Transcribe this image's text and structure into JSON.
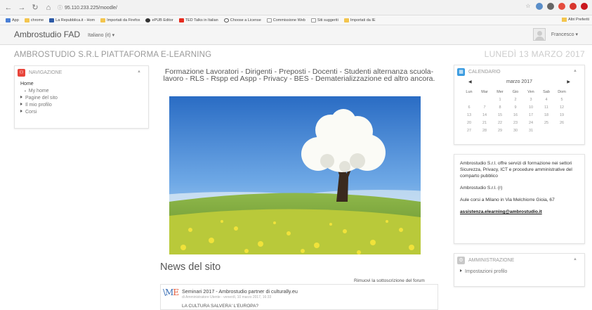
{
  "browser": {
    "url_host": "95.110.233.225",
    "url_path": "/moodle/",
    "bookmarks": [
      "App",
      "chrome",
      "La Repubblica.it - Hom",
      "Importati da Firefox",
      "ePUB Editor",
      "TED Talks in Italian",
      "Choose a License",
      "Commissione Web",
      "Siti suggeriti",
      "Importati da IE"
    ],
    "bookmarks_right": "Altri Preferiti"
  },
  "navbar": {
    "brand": "Ambrostudio FAD",
    "language": "Italiano (it) ▾",
    "user_name": "Francesco ▾"
  },
  "header": {
    "site_name": "AMBROSTUDIO S.R.L PIATTAFORMA E-LEARNING",
    "date": "LUNEDÌ 13 MARZO 2017"
  },
  "navigation": {
    "title": "NAVIGAZIONE",
    "home": "Home",
    "items": [
      "My home",
      "Pagine del sito",
      "Il mio profilo",
      "Corsi"
    ]
  },
  "calendar": {
    "title": "CALENDARIO",
    "prev": "◀",
    "next": "▶",
    "month": "marzo 2017",
    "weekdays": [
      "Lun",
      "Mar",
      "Mer",
      "Gio",
      "Ven",
      "Sab",
      "Dom"
    ],
    "weeks": [
      [
        "",
        "",
        "1",
        "2",
        "3",
        "4",
        "5"
      ],
      [
        "6",
        "7",
        "8",
        "9",
        "10",
        "11",
        "12"
      ],
      [
        "13",
        "14",
        "15",
        "16",
        "17",
        "18",
        "19"
      ],
      [
        "20",
        "21",
        "22",
        "23",
        "24",
        "25",
        "26"
      ],
      [
        "27",
        "28",
        "29",
        "30",
        "31",
        "",
        ""
      ]
    ]
  },
  "info": {
    "description": "Ambrostudio S.r.l. offre servizi di formazione nei settori Sicurezza, Privacy, ICT e procedure amministrative del comparto pubblico",
    "company": "Ambrostudio S.r.l. (r)",
    "address": "Aule corsi a Milano in Via Melchiorre Gioia, 67",
    "email": "assistenza.elearning@ambrostudio.it"
  },
  "admin": {
    "title": "AMMINISTRAZIONE",
    "items": [
      "Impostazioni profilo"
    ]
  },
  "main": {
    "headline": "Formazione Lavoratori - Dirigenti - Preposti - Docenti - Studenti alternanza scuola-lavoro - RLS - Rspp ed Aspp - Privacy - BES - Dematerializzazione ed altro ancora.",
    "news_title": "News del sito",
    "unsubscribe": "Rimuovi la sottoscrizione del forum",
    "post": {
      "title": "Seminari 2017 - Ambrostudio partner di culturally.eu",
      "meta": "di Amministratore Utente - venerdì, 10 marzo 2017, 16:33",
      "snippet": "LA CULTURA SALVERA' L'EUROPA?"
    }
  },
  "colors": {
    "nav_icon": "#e8443a",
    "cal_icon": "#3a9be0",
    "admin_icon": "#c8c8c8"
  }
}
